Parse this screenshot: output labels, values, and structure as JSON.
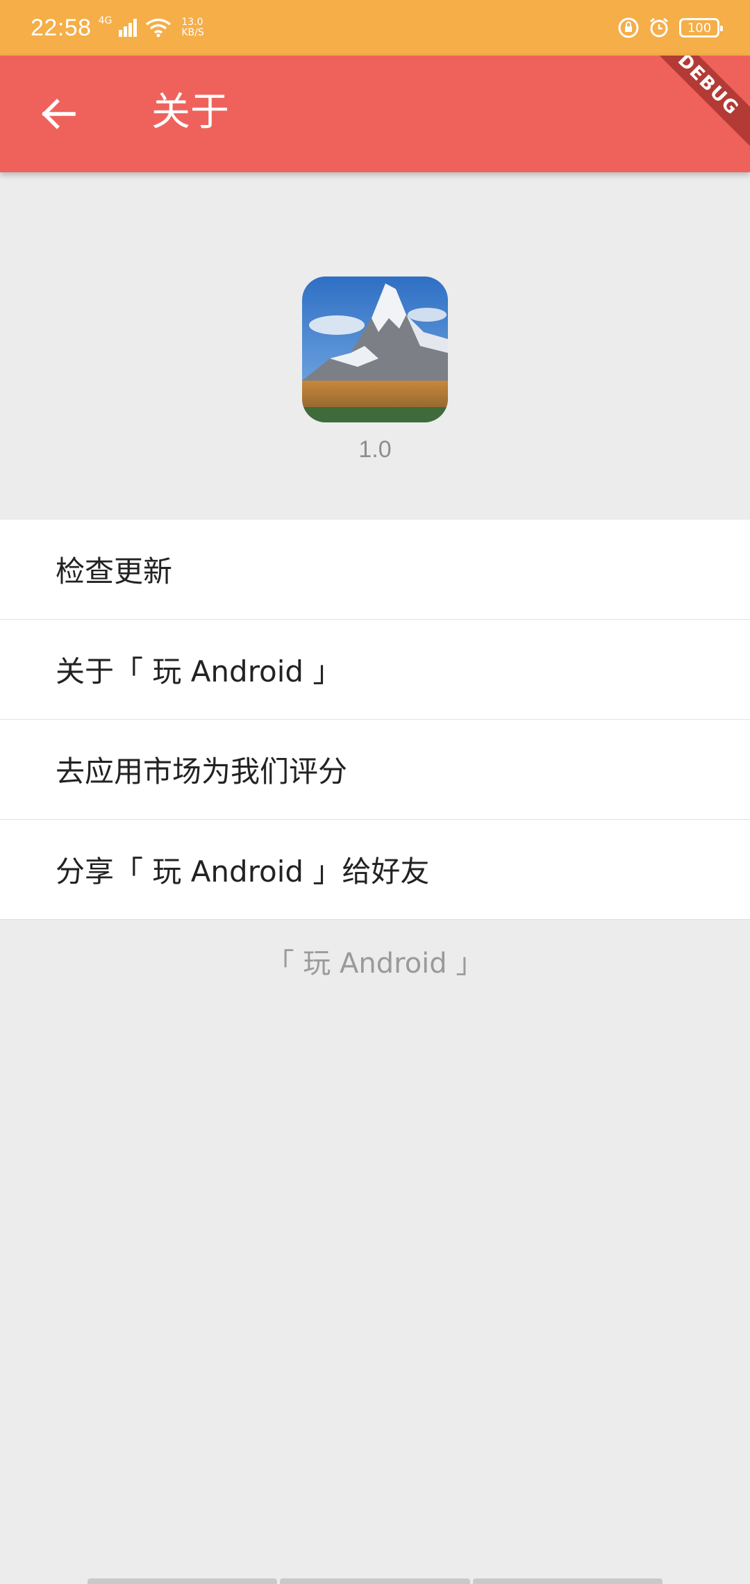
{
  "status_bar": {
    "time": "22:58",
    "network": "4G",
    "speed_value": "13.0",
    "speed_unit": "KB/S",
    "battery": "100"
  },
  "app_bar": {
    "title": "关于",
    "back_icon": "arrow-back-icon",
    "debug_banner": "DEBUG"
  },
  "about": {
    "logo_icon": "mountain-logo",
    "version": "1.0"
  },
  "menu": {
    "items": [
      {
        "label": "检查更新"
      },
      {
        "label": "关于「 玩 Android 」"
      },
      {
        "label": "去应用市场为我们评分"
      },
      {
        "label": "分享「 玩 Android 」给好友"
      }
    ]
  },
  "footer": {
    "label": "「 玩 Android 」"
  },
  "colors": {
    "status_bar": "#f5ae48",
    "app_bar": "#ef625c",
    "background": "#ececec"
  }
}
